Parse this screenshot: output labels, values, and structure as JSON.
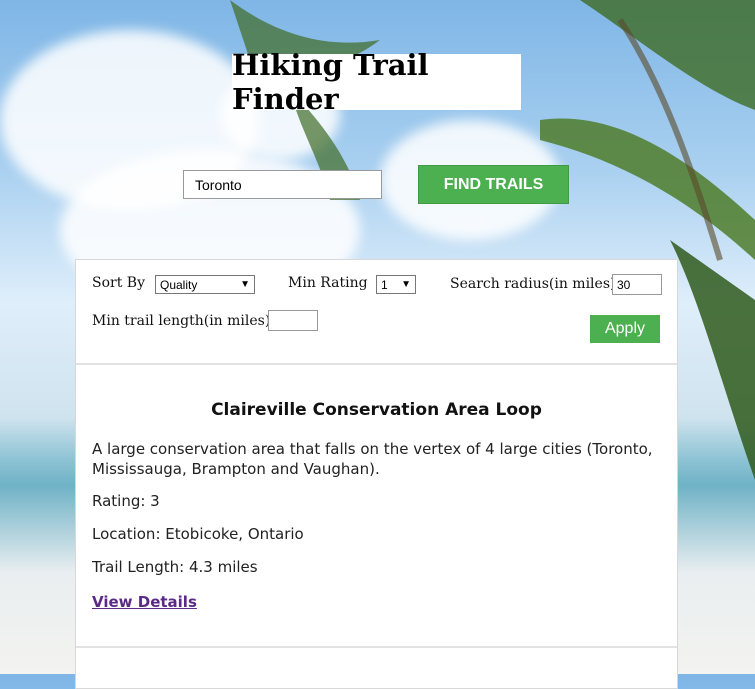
{
  "header": {
    "title": "Hiking Trail Finder"
  },
  "search": {
    "value": "Toronto",
    "button_label": "FIND TRAILS"
  },
  "filters": {
    "sort_by_label": "Sort By",
    "sort_by_value": "Quality",
    "min_rating_label": "Min Rating",
    "min_rating_value": "1",
    "radius_label": "Search radius(in miles)",
    "radius_value": "30",
    "min_length_label": "Min trail length(in miles)",
    "min_length_value": "",
    "apply_label": "Apply"
  },
  "results": [
    {
      "name": "Claireville Conservation Area Loop",
      "description": "A large conservation area that falls on the vertex of 4 large cities (Toronto, Mississauga, Brampton and Vaughan).",
      "rating": "Rating: 3",
      "location": "Location: Etobicoke, Ontario",
      "length": "Trail Length: 4.3 miles",
      "link_label": "View Details"
    }
  ],
  "colors": {
    "accent": "#4caf50",
    "link": "#5b2a86"
  },
  "icons": {
    "select_caret": "caret-down-icon"
  }
}
